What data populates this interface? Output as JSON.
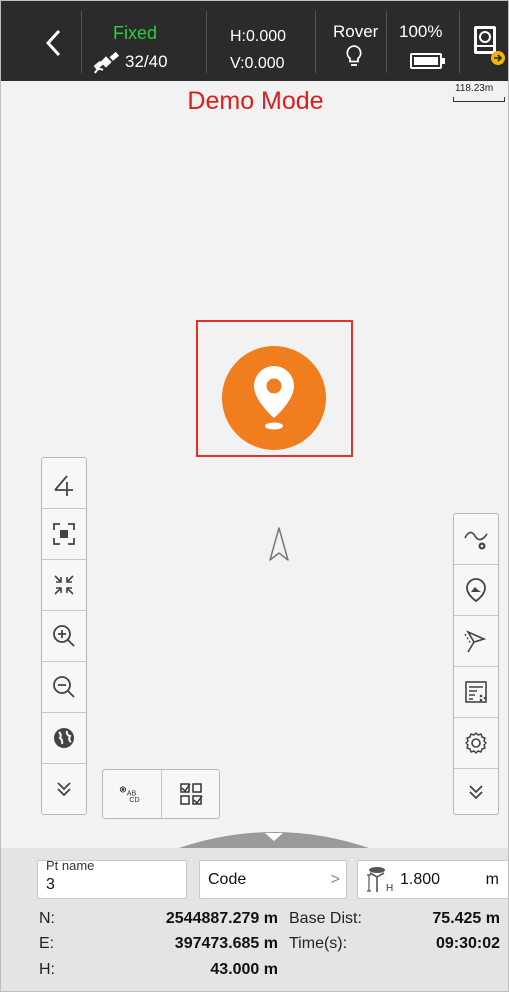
{
  "status": {
    "fix": "Fixed",
    "fix_color": "#2ecc40",
    "satellites": "32/40",
    "h": "H:0.000",
    "v": "V:0.000",
    "mode": "Rover",
    "battery": "100%"
  },
  "map": {
    "banner": "Demo Mode",
    "scale": "118.23m",
    "accent": "#f07d1e"
  },
  "left_toolbar": [
    "draw-line-icon",
    "zoom-extent-icon",
    "shrink-icon",
    "zoom-in-icon",
    "zoom-out-icon",
    "globe-icon",
    "expand-down-icon"
  ],
  "right_toolbar": [
    "curve-settings-icon",
    "point-pin-icon",
    "stakeout-icon",
    "point-list-icon",
    "settings-icon",
    "expand-down-icon"
  ],
  "label_tools": {
    "label_text": "AB CD"
  },
  "panel": {
    "pt_caption": "Pt name",
    "pt_value": "3",
    "code": "Code",
    "code_chevron": ">",
    "antenna_value": "1.800",
    "antenna_unit": "m",
    "n_label": "N:",
    "n_value": "2544887.279 m",
    "e_label": "E:",
    "e_value": "397473.685 m",
    "h_label": "H:",
    "h_value": "43.000 m",
    "base_label": "Base Dist:",
    "base_value": "75.425 m",
    "time_label": "Time(s):",
    "time_value": "09:30:02"
  }
}
